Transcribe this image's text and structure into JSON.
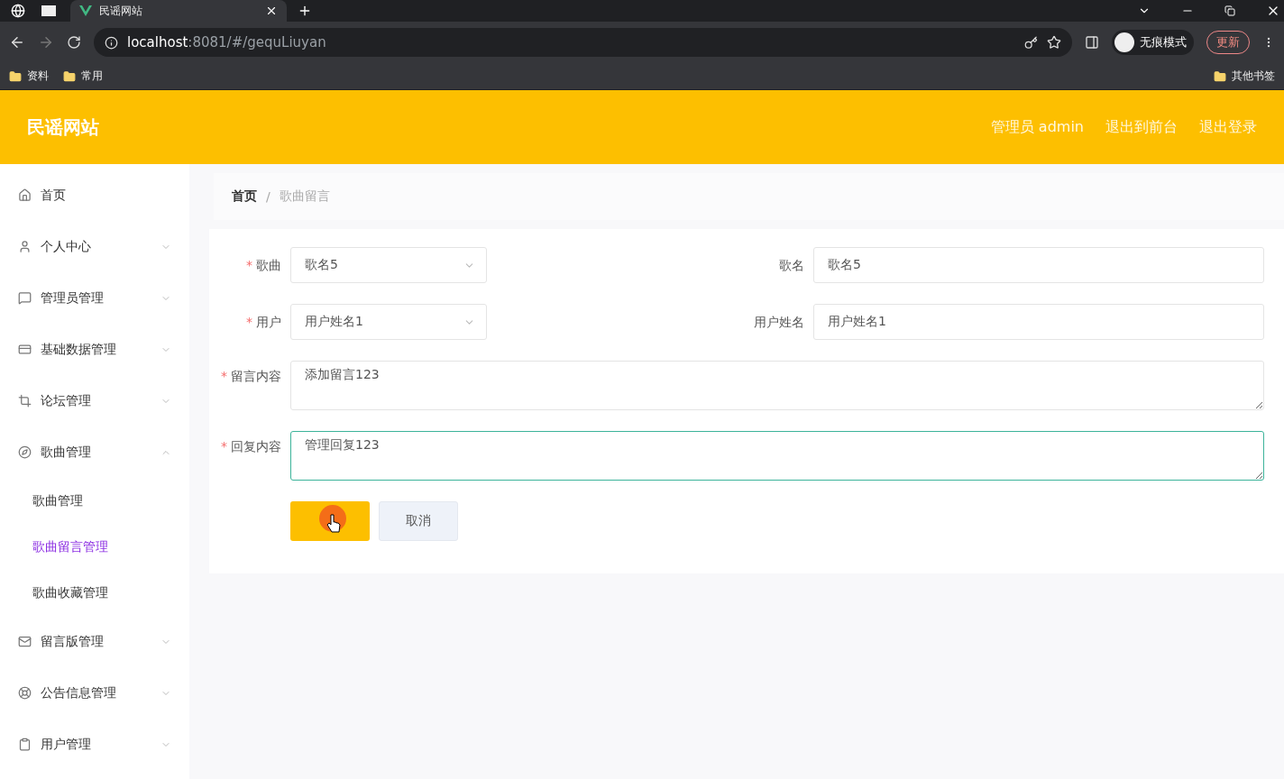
{
  "browser": {
    "tab_title": "民谣网站",
    "url_host": "localhost",
    "url_path": ":8081/#/gequLiuyan",
    "profile": "无痕模式",
    "update": "更新",
    "bookmarks": [
      "资料",
      "常用"
    ],
    "other_bookmarks": "其他书签"
  },
  "header": {
    "title": "民谣网站",
    "links": [
      "管理员 admin",
      "退出到前台",
      "退出登录"
    ]
  },
  "sidebar": {
    "items": [
      {
        "label": "首页"
      },
      {
        "label": "个人中心",
        "expanded": false
      },
      {
        "label": "管理员管理",
        "expanded": false
      },
      {
        "label": "基础数据管理",
        "expanded": false
      },
      {
        "label": "论坛管理",
        "expanded": false
      },
      {
        "label": "歌曲管理",
        "expanded": true,
        "children": [
          {
            "label": "歌曲管理",
            "selected": false
          },
          {
            "label": "歌曲留言管理",
            "selected": true
          },
          {
            "label": "歌曲收藏管理",
            "selected": false
          }
        ]
      },
      {
        "label": "留言版管理",
        "expanded": false
      },
      {
        "label": "公告信息管理",
        "expanded": false
      },
      {
        "label": "用户管理",
        "expanded": false
      }
    ]
  },
  "breadcrumb": [
    "首页",
    "歌曲留言"
  ],
  "breadcrumb_separator": "/",
  "form": {
    "rows": [
      {
        "left": {
          "label": "歌曲",
          "required_mark": "*",
          "value": "歌名5"
        },
        "right": {
          "label": "歌名",
          "value": "歌名5"
        }
      },
      {
        "left": {
          "label": "用户",
          "required_mark": "*",
          "value": "用户姓名1"
        },
        "right": {
          "label": "用户姓名",
          "value": "用户姓名1"
        }
      }
    ],
    "textareas": [
      {
        "label": "留言内容",
        "required_mark": "*",
        "value": "添加留言123",
        "focused": false
      },
      {
        "label": "回复内容",
        "required_mark": "*",
        "value": "管理回复123",
        "focused": true
      }
    ],
    "cancel": "取消"
  }
}
